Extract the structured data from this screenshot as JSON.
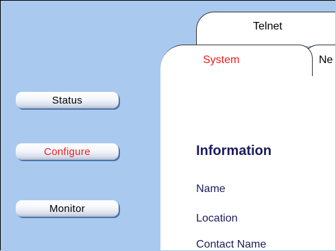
{
  "tabs": {
    "telnet": "Telnet",
    "system": "System",
    "network": "Ne"
  },
  "nav": {
    "status": "Status",
    "configure": "Configure",
    "monitor": "Monitor"
  },
  "content": {
    "section_title": "Information",
    "fields": [
      "Name",
      "Location",
      "Contact Name"
    ]
  },
  "colors": {
    "background": "#a9c9ef",
    "active": "#ee1c1c",
    "text": "#1c1c5e"
  }
}
